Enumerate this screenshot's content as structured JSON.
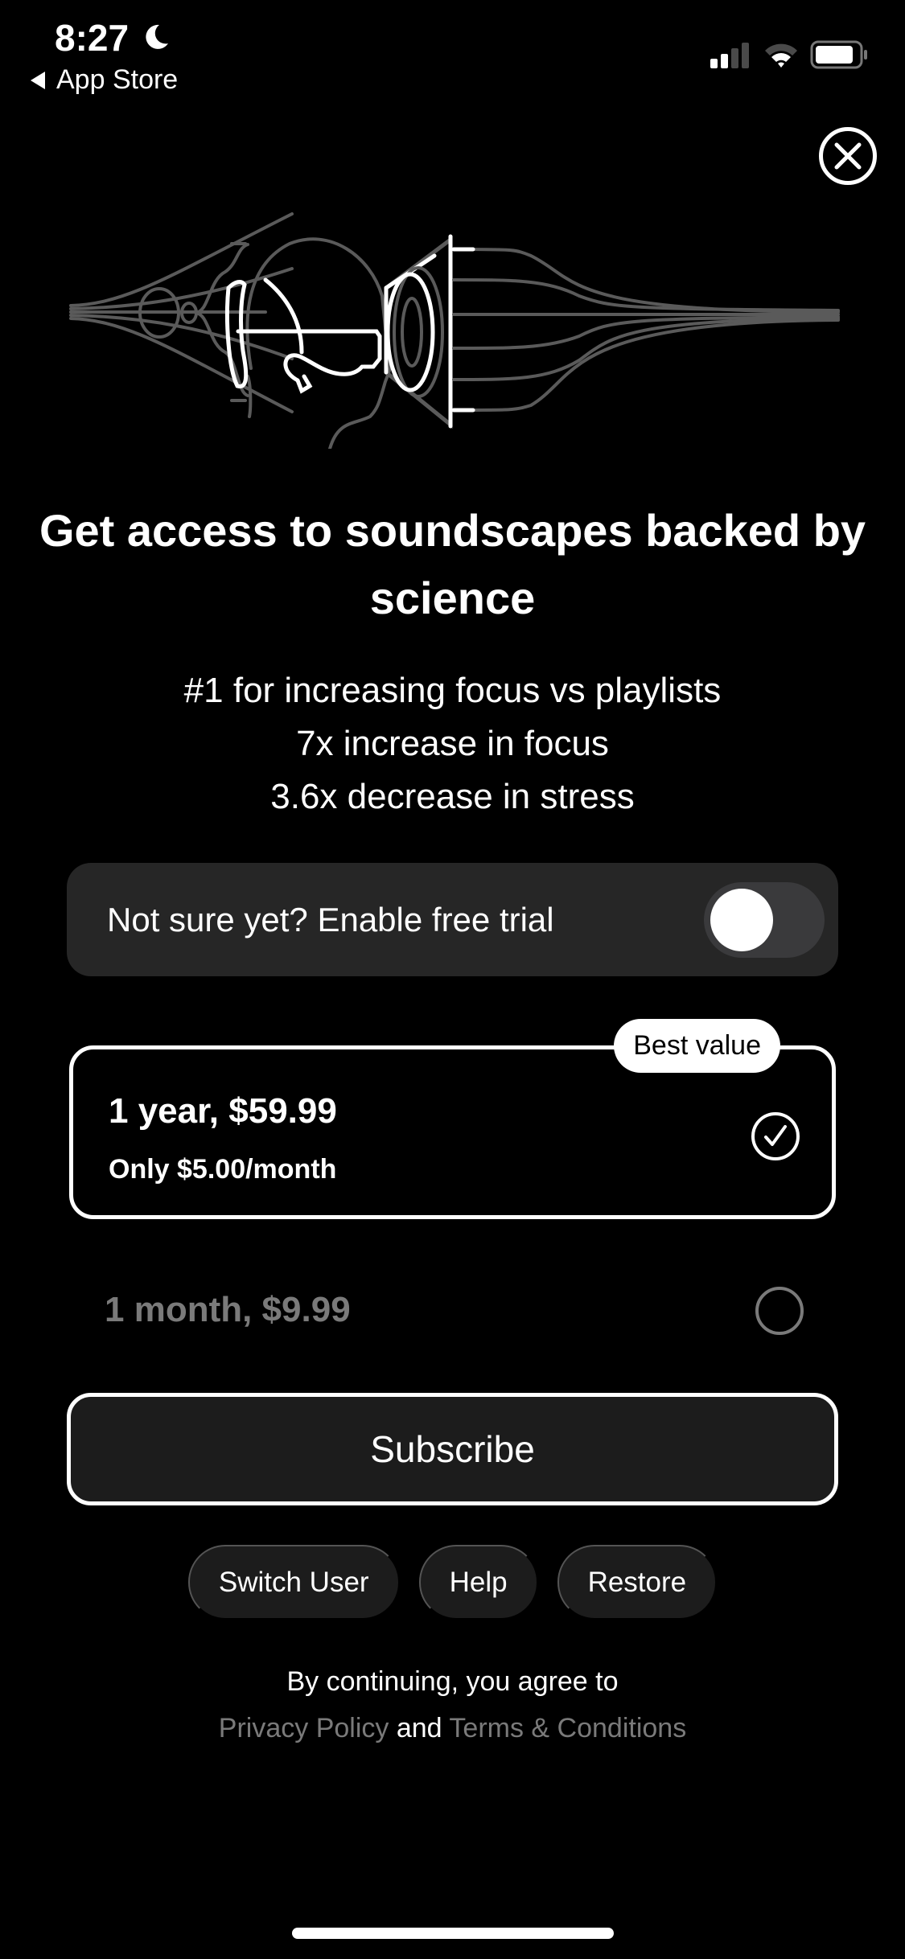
{
  "status_bar": {
    "time": "8:27",
    "focus_icon": "moon-icon",
    "back_label": "App Store",
    "signal_bars_active": 2,
    "signal_bars_total": 4,
    "icons": [
      "cellular-signal-icon",
      "wifi-icon",
      "battery-icon"
    ]
  },
  "close_icon": "close-icon",
  "hero": {
    "illustration": "head-with-soundwaves-illustration"
  },
  "headline": "Get access to soundscapes backed by science",
  "stats": [
    "#1 for increasing focus vs playlists",
    "7x increase in focus",
    "3.6x decrease in stress"
  ],
  "trial": {
    "label": "Not sure yet? Enable free trial",
    "enabled": false
  },
  "plans": [
    {
      "title": "1 year, $59.99",
      "subtitle": "Only $5.00/month",
      "badge": "Best value",
      "selected": true
    },
    {
      "title": "1 month, $9.99",
      "selected": false
    }
  ],
  "subscribe_label": "Subscribe",
  "footer_buttons": [
    "Switch User",
    "Help",
    "Restore"
  ],
  "legal": {
    "prefix": "By continuing, you agree to",
    "privacy": "Privacy Policy",
    "conjunction": "and",
    "terms": "Terms & Conditions"
  },
  "colors": {
    "background": "#000000",
    "surface": "#262626",
    "button_surface": "#1c1c1c",
    "muted_text": "#7a7a7a",
    "illustration_gray": "#5a5a5a",
    "foreground": "#ffffff"
  }
}
